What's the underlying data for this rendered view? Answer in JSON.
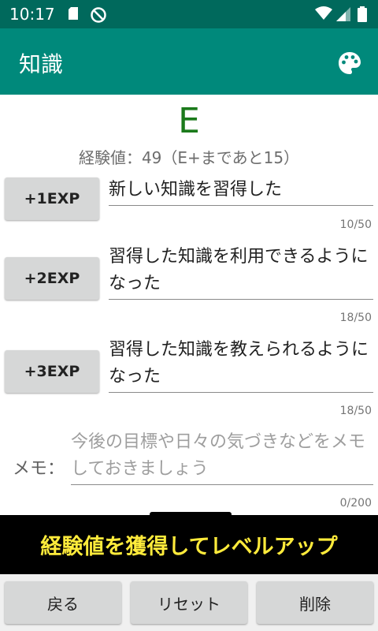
{
  "status_bar": {
    "time": "10:17",
    "icons": [
      "sd-card-icon",
      "no-disturb-icon",
      "wifi-icon",
      "signal-icon",
      "battery-icon"
    ]
  },
  "app_bar": {
    "title": "知識",
    "action_icon": "palette-icon"
  },
  "grade": "E",
  "exp_text": "経験値：49（E+まであと15）",
  "exp_items": [
    {
      "button": "+1EXP",
      "text": "新しい知識を習得した",
      "counter": "10/50"
    },
    {
      "button": "+2EXP",
      "text": "習得した知識を利用できるようになった",
      "counter": "18/50"
    },
    {
      "button": "+3EXP",
      "text": "習得した知識を教えられるようになった",
      "counter": "18/50"
    }
  ],
  "memo": {
    "label": "メモ：",
    "placeholder": "今後の目標や日々の気づきなどをメモしておきましょう",
    "counter": "0/200"
  },
  "banner": "経験値を獲得してレベルアップ",
  "bottom_buttons": [
    "戻る",
    "リセット",
    "削除"
  ],
  "colors": {
    "status_bar": "#00695c",
    "app_bar": "#00897b",
    "grade": "#1b7a1b",
    "banner_bg": "#000000",
    "banner_text": "#ffeb3b"
  }
}
